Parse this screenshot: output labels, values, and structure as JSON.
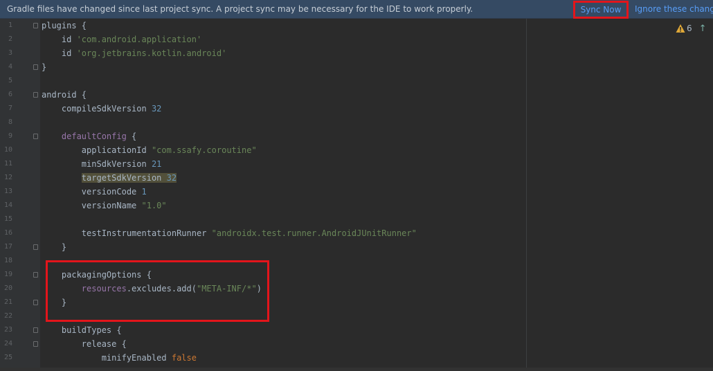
{
  "banner": {
    "message": "Gradle files have changed since last project sync. A project sync may be necessary for the IDE to work properly.",
    "sync_now": "Sync Now",
    "ignore": "Ignore these changes"
  },
  "inspection": {
    "warning_count": "6",
    "warning_icon": "warning-triangle-icon",
    "nav_icon": "arrow-up-icon"
  },
  "colors": {
    "banner_bg": "#354a63",
    "editor_bg": "#2b2b2b",
    "link": "#589df6",
    "string": "#6a8759",
    "number": "#6897bb",
    "keyword": "#cc7832",
    "property": "#9876aa",
    "highlight_border": "#e3151b"
  },
  "editor": {
    "lines": [
      {
        "n": "1",
        "fold": true,
        "tokens": [
          {
            "t": "plugins {",
            "c": "plain"
          }
        ]
      },
      {
        "n": "2",
        "fold": false,
        "tokens": [
          {
            "t": "    id ",
            "c": "plain"
          },
          {
            "t": "'com.android.application'",
            "c": "str"
          }
        ]
      },
      {
        "n": "3",
        "fold": false,
        "tokens": [
          {
            "t": "    id ",
            "c": "plain"
          },
          {
            "t": "'org.jetbrains.kotlin.android'",
            "c": "str"
          }
        ]
      },
      {
        "n": "4",
        "fold": true,
        "tokens": [
          {
            "t": "}",
            "c": "plain"
          }
        ]
      },
      {
        "n": "5",
        "fold": false,
        "tokens": []
      },
      {
        "n": "6",
        "fold": true,
        "tokens": [
          {
            "t": "android {",
            "c": "plain"
          }
        ]
      },
      {
        "n": "7",
        "fold": false,
        "tokens": [
          {
            "t": "    compileSdkVersion ",
            "c": "plain"
          },
          {
            "t": "32",
            "c": "num"
          }
        ]
      },
      {
        "n": "8",
        "fold": false,
        "tokens": []
      },
      {
        "n": "9",
        "fold": true,
        "tokens": [
          {
            "t": "    ",
            "c": "plain"
          },
          {
            "t": "defaultConfig",
            "c": "prop"
          },
          {
            "t": " {",
            "c": "plain"
          }
        ]
      },
      {
        "n": "10",
        "fold": false,
        "tokens": [
          {
            "t": "        applicationId ",
            "c": "plain"
          },
          {
            "t": "\"com.ssafy.coroutine\"",
            "c": "str"
          }
        ]
      },
      {
        "n": "11",
        "fold": false,
        "tokens": [
          {
            "t": "        minSdkVersion ",
            "c": "plain"
          },
          {
            "t": "21",
            "c": "num"
          }
        ]
      },
      {
        "n": "12",
        "fold": false,
        "tokens": [
          {
            "t": "        ",
            "c": "plain"
          },
          {
            "t": "targetSdkVersion ",
            "c": "hl"
          },
          {
            "t": "32",
            "c": "hlnum"
          }
        ]
      },
      {
        "n": "13",
        "fold": false,
        "tokens": [
          {
            "t": "        versionCode ",
            "c": "plain"
          },
          {
            "t": "1",
            "c": "num"
          }
        ]
      },
      {
        "n": "14",
        "fold": false,
        "tokens": [
          {
            "t": "        versionName ",
            "c": "plain"
          },
          {
            "t": "\"1.0\"",
            "c": "str"
          }
        ]
      },
      {
        "n": "15",
        "fold": false,
        "tokens": []
      },
      {
        "n": "16",
        "fold": false,
        "tokens": [
          {
            "t": "        testInstrumentationRunner ",
            "c": "plain"
          },
          {
            "t": "\"androidx.test.runner.AndroidJUnitRunner\"",
            "c": "str"
          }
        ]
      },
      {
        "n": "17",
        "fold": true,
        "tokens": [
          {
            "t": "    }",
            "c": "plain"
          }
        ]
      },
      {
        "n": "18",
        "fold": false,
        "tokens": []
      },
      {
        "n": "19",
        "fold": true,
        "tokens": [
          {
            "t": "    packagingOptions {",
            "c": "plain"
          }
        ]
      },
      {
        "n": "20",
        "fold": false,
        "tokens": [
          {
            "t": "        ",
            "c": "plain"
          },
          {
            "t": "resources",
            "c": "prop"
          },
          {
            "t": ".excludes.add(",
            "c": "plain"
          },
          {
            "t": "\"META-INF/*\"",
            "c": "str"
          },
          {
            "t": ")",
            "c": "plain"
          }
        ]
      },
      {
        "n": "21",
        "fold": true,
        "tokens": [
          {
            "t": "    }",
            "c": "plain"
          }
        ]
      },
      {
        "n": "22",
        "fold": false,
        "tokens": []
      },
      {
        "n": "23",
        "fold": true,
        "tokens": [
          {
            "t": "    buildTypes {",
            "c": "plain"
          }
        ]
      },
      {
        "n": "24",
        "fold": true,
        "tokens": [
          {
            "t": "        release {",
            "c": "plain"
          }
        ]
      },
      {
        "n": "25",
        "fold": false,
        "tokens": [
          {
            "t": "            minifyEnabled ",
            "c": "plain"
          },
          {
            "t": "false",
            "c": "kw"
          }
        ]
      }
    ]
  }
}
